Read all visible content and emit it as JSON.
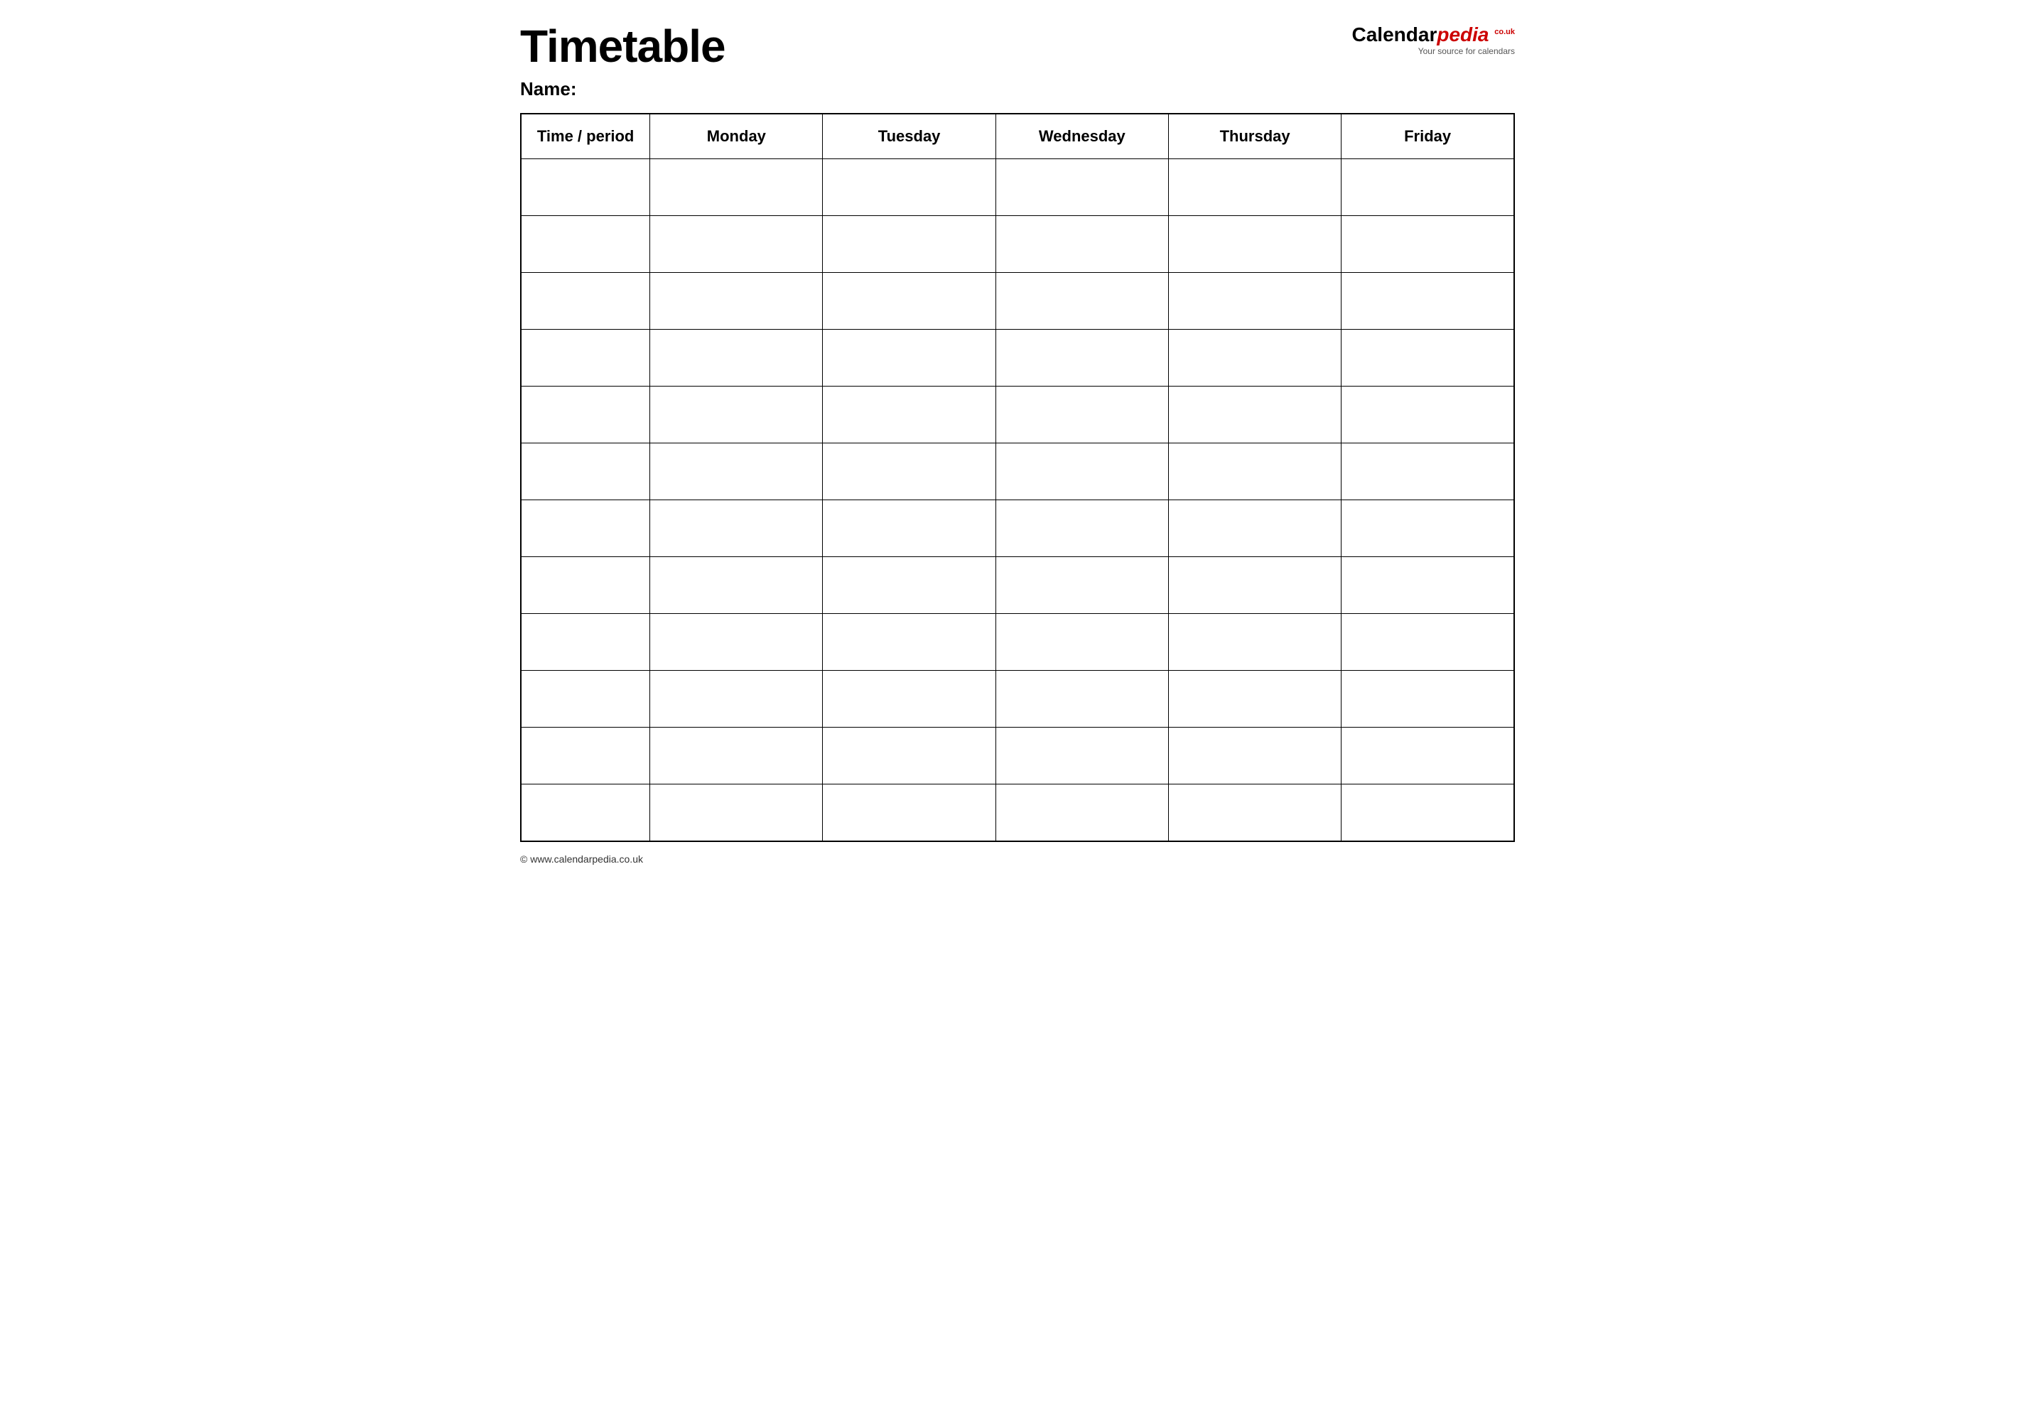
{
  "header": {
    "title": "Timetable",
    "logo": {
      "calendar": "Calendar",
      "pedia": "pedia",
      "couk": "co.uk",
      "tagline": "Your source for calendars"
    }
  },
  "name_section": {
    "label": "Name:"
  },
  "table": {
    "columns": [
      {
        "id": "time",
        "label": "Time / period"
      },
      {
        "id": "monday",
        "label": "Monday"
      },
      {
        "id": "tuesday",
        "label": "Tuesday"
      },
      {
        "id": "wednesday",
        "label": "Wednesday"
      },
      {
        "id": "thursday",
        "label": "Thursday"
      },
      {
        "id": "friday",
        "label": "Friday"
      }
    ],
    "row_count": 12
  },
  "footer": {
    "url": "www.calendarpedia.co.uk"
  }
}
